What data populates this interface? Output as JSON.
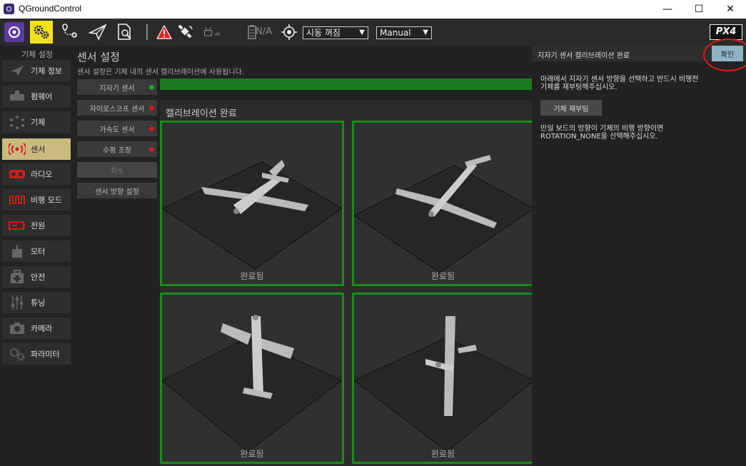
{
  "window": {
    "title": "QGroundControl",
    "minimize": "—",
    "maximize": "☐",
    "close": "✕"
  },
  "toolbar": {
    "battery_text": "N/A",
    "arm_dropdown": "시동 꺼짐",
    "mode_dropdown": "Manual",
    "logo": "PX4"
  },
  "sidebar": {
    "header": "기체 설정",
    "items": [
      {
        "label": "기체 정보",
        "icon": "plane-icon"
      },
      {
        "label": "펌웨어",
        "icon": "firmware-icon"
      },
      {
        "label": "기체",
        "icon": "airframe-icon"
      },
      {
        "label": "센서",
        "icon": "sensor-icon"
      },
      {
        "label": "라디오",
        "icon": "radio-icon"
      },
      {
        "label": "비행 모드",
        "icon": "flight-mode-icon"
      },
      {
        "label": "전원",
        "icon": "battery-icon"
      },
      {
        "label": "모터",
        "icon": "motor-icon"
      },
      {
        "label": "안전",
        "icon": "safety-icon"
      },
      {
        "label": "튜닝",
        "icon": "tuning-icon"
      },
      {
        "label": "카메라",
        "icon": "camera-icon"
      },
      {
        "label": "파라미터",
        "icon": "parameters-icon"
      }
    ]
  },
  "main": {
    "title": "센서 설정",
    "description": "센서 설정은 기체 내의 센서 캘리브레이션에 사용됩니다.",
    "sensor_buttons": [
      {
        "label": "지자기 센서",
        "status_color": "#1ea81e"
      },
      {
        "label": "자이로스코프 센서",
        "status_color": "#d01b1b"
      },
      {
        "label": "가속도 센서",
        "status_color": "#d01b1b"
      },
      {
        "label": "수평 조정",
        "status_color": "#d01b1b"
      },
      {
        "label": "취소",
        "status_color": ""
      },
      {
        "label": "센서 방향 설정",
        "status_color": ""
      }
    ],
    "progress": 1.0,
    "calibration_title": "캘리브레이션 완료",
    "orientations": [
      {
        "label": "완료됨"
      },
      {
        "label": "완료됨"
      },
      {
        "label": "완료됨"
      },
      {
        "label": "완료됨"
      }
    ]
  },
  "right_panel": {
    "header": "지자기 센서 캘리브레이션 완료",
    "ok_label": "확인",
    "instruction_line1": "아래에서 지자기 센서 방향을 선택하고 반드시 비행전",
    "instruction_line2": "기체를 재부팅해주십시오.",
    "reboot_label": "기체 재부팅",
    "note_line1": "만일 보드의 방향이 기체의 비행 방향이면",
    "note_line2": "ROTATION_NONE을 선택해주십시오."
  },
  "colors": {
    "accent": "#c9bb7e",
    "complete": "#1a8c1a",
    "error": "#d01b1b",
    "ok_button": "#8fb3c5"
  }
}
